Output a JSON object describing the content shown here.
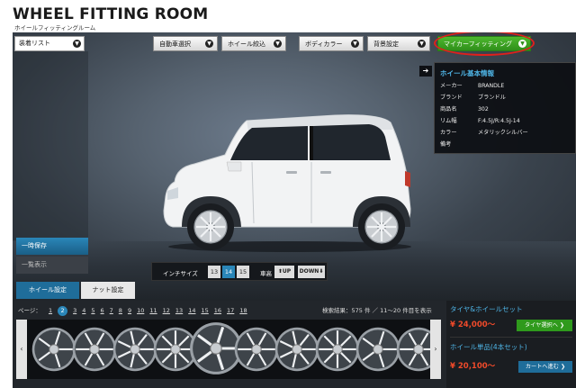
{
  "header": {
    "title": "WHEEL FITTING ROOM",
    "subtitle": "ホイールフィッティングルーム"
  },
  "toolbar": {
    "list_dropdown": "装着リスト",
    "car_select": "自動車選択",
    "wheel_filter": "ホイール絞込",
    "body_color": "ボディカラー",
    "background": "背景設定",
    "my_car_fitting": "マイカーフィッティング"
  },
  "info_panel": {
    "title": "ホイール基本情報",
    "rows": [
      {
        "key": "メーカー",
        "value": "BRANDLE"
      },
      {
        "key": "ブランド",
        "value": "ブランドル"
      },
      {
        "key": "商品名",
        "value": "302"
      },
      {
        "key": "リム幅",
        "value": "F:4.5J/R:4.5J-14"
      },
      {
        "key": "カラー",
        "value": "メタリックシルバー"
      },
      {
        "key": "備考",
        "value": ""
      }
    ]
  },
  "side": {
    "save": "一時保存",
    "list": "一覧表示"
  },
  "inch": {
    "label": "インチサイズ",
    "sizes": [
      "13",
      "14",
      "15"
    ],
    "active": "14",
    "height_label": "車高",
    "up": "UP",
    "down": "DOWN"
  },
  "tabs": {
    "wheel": "ホイール設定",
    "nut": "ナット設定"
  },
  "pager": {
    "label": "ページ：",
    "pages": [
      "1",
      "2",
      "3",
      "4",
      "5",
      "6",
      "7",
      "8",
      "9",
      "10",
      "11",
      "12",
      "13",
      "14",
      "15",
      "16",
      "17",
      "18"
    ],
    "current": "2",
    "results": "検索結果：575 件 ／ 11〜20 件目を表示"
  },
  "price": {
    "set_title": "タイヤ&ホイールセット",
    "set_price": "¥ 24,000〜",
    "set_button": "タイヤ選択へ ❯",
    "single_title": "ホイール単品(4本セット)",
    "single_price": "¥ 20,100〜",
    "single_button": "カートへ進む ❯"
  },
  "colors": {
    "accent_blue": "#2a86b8",
    "accent_green": "#2f9a1c",
    "price_red": "#f04a2a",
    "title_blue": "#4fb6e8"
  }
}
